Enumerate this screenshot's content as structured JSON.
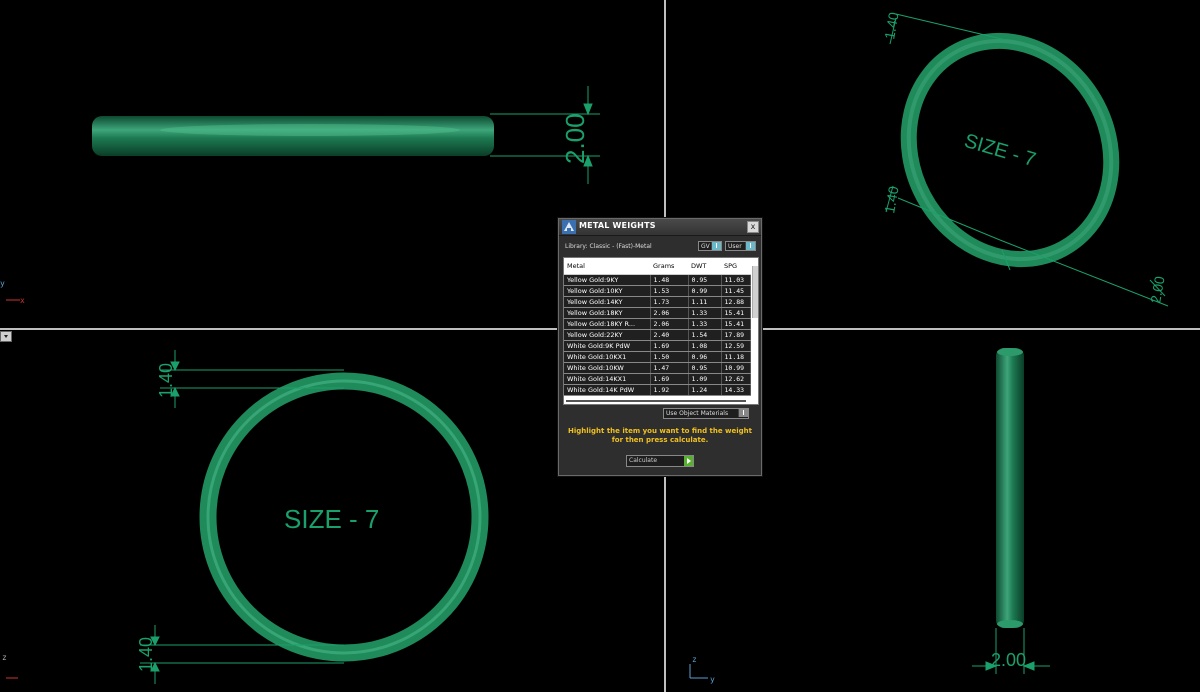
{
  "viewports": {
    "top_left": {
      "dimension": "2.00",
      "axis_x": "x",
      "axis_y": "y"
    },
    "top_right": {
      "size_label": "SIZE - 7",
      "dim_top": "1.40",
      "dim_left": "1.40",
      "dim_bottom": "2.00"
    },
    "bottom_left": {
      "size_label": "SIZE - 7",
      "dim_top": "1.40",
      "dim_bottom": "1.40",
      "axis_z": "z"
    },
    "bottom_right": {
      "dimension": "2.00",
      "axis_z": "z",
      "axis_y": "y"
    }
  },
  "dialog": {
    "title": "METAL WEIGHTS",
    "library_label": "Library: Classic - (Fast)-Metal",
    "unit_select": "GV",
    "user_select": "User",
    "columns": [
      "Metal",
      "Grams",
      "DWT",
      "SPG"
    ],
    "rows": [
      [
        "Yellow Gold:9KY",
        "1.48",
        "0.95",
        "11.03"
      ],
      [
        "Yellow Gold:10KY",
        "1.53",
        "0.99",
        "11.45"
      ],
      [
        "Yellow Gold:14KY",
        "1.73",
        "1.11",
        "12.88"
      ],
      [
        "Yellow Gold:18KY",
        "2.06",
        "1.33",
        "15.41"
      ],
      [
        "Yellow Gold:18KY R...",
        "2.06",
        "1.33",
        "15.41"
      ],
      [
        "Yellow Gold:22KY",
        "2.40",
        "1.54",
        "17.89"
      ],
      [
        "White Gold:9K PdW",
        "1.69",
        "1.08",
        "12.59"
      ],
      [
        "White Gold:10KX1",
        "1.50",
        "0.96",
        "11.18"
      ],
      [
        "White Gold:10KW",
        "1.47",
        "0.95",
        "10.99"
      ],
      [
        "White Gold:14KX1",
        "1.69",
        "1.09",
        "12.62"
      ],
      [
        "White Gold:14K PdW",
        "1.92",
        "1.24",
        "14.33"
      ]
    ],
    "materials_select": "Use Object Materials",
    "hint_line1": "Highlight the item you want to find the weight",
    "hint_line2": "for then press calculate.",
    "calculate_label": "Calculate",
    "close_glyph": "x"
  }
}
